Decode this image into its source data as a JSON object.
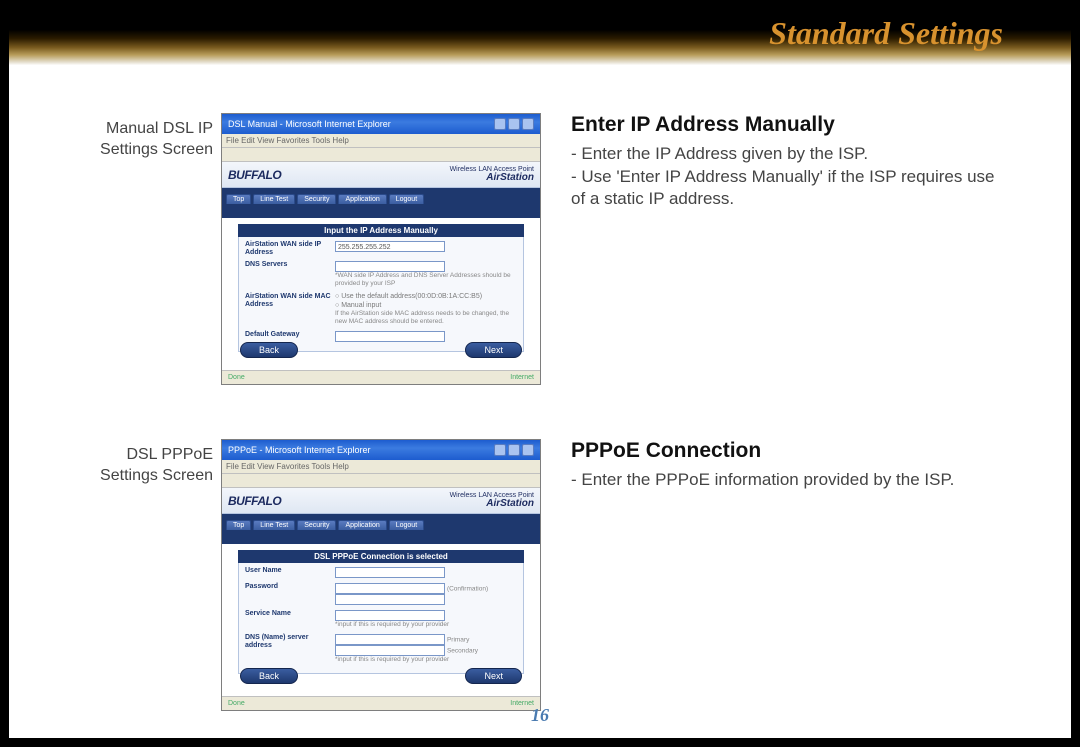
{
  "header": {
    "title": "Standard Settings"
  },
  "page_number": "16",
  "sections": [
    {
      "caption": "Manual DSL IP Settings Screen",
      "screenshot": {
        "window_title": "DSL Manual - Microsoft Internet Explorer",
        "menubar": "File   Edit   View   Favorites   Tools   Help",
        "brand": "BUFFALO",
        "brand_tag_top": "Wireless LAN Access Point",
        "brand_tag_bottom": "AirStation",
        "tabs": [
          "Top",
          "Line Test",
          "Security",
          "Application",
          "Logout"
        ],
        "panel_title": "Input the IP Address Manually",
        "fields": [
          {
            "label": "AirStation WAN side IP Address",
            "value_input": "255.255.255.252",
            "note": ""
          },
          {
            "label": "DNS Servers",
            "value_input": "",
            "note": "*WAN side IP Address and DNS Server Addresses should be provided by your ISP"
          },
          {
            "label": "AirStation WAN side MAC Address",
            "radio1": "Use the default address(00:0D:0B:1A:CC:B5)",
            "radio2": "Manual input",
            "note": "If the AirStation side MAC address needs to be changed, the new MAC address should be entered."
          },
          {
            "label": "Default Gateway",
            "value_input": "",
            "note": ""
          }
        ],
        "back": "Back",
        "next": "Next",
        "status_left": "Done",
        "status_right": "Internet"
      },
      "heading": "Enter IP Address Manually",
      "paragraphs": [
        "- Enter the IP Address given by the ISP.",
        "- Use 'Enter IP Address Manually' if the ISP requires use of a static IP address."
      ]
    },
    {
      "caption": "DSL PPPoE Settings Screen",
      "screenshot": {
        "window_title": "PPPoE - Microsoft Internet Explorer",
        "menubar": "File   Edit   View   Favorites   Tools   Help",
        "brand": "BUFFALO",
        "brand_tag_top": "Wireless LAN Access Point",
        "brand_tag_bottom": "AirStation",
        "tabs": [
          "Top",
          "Line Test",
          "Security",
          "Application",
          "Logout"
        ],
        "panel_title": "DSL PPPoE Connection is selected",
        "fields": [
          {
            "label": "User Name",
            "value_input": "",
            "note": ""
          },
          {
            "label": "Password",
            "value_input": "",
            "side": "(Confirmation)",
            "note": ""
          },
          {
            "label": "Service Name",
            "value_input": "",
            "note": "*input if this is required by your provider"
          },
          {
            "label": "DNS (Name) server address",
            "value_input": "",
            "side": "Primary",
            "side2": "Secondary",
            "note": "*input if this is required by your provider"
          }
        ],
        "back": "Back",
        "next": "Next",
        "status_left": "Done",
        "status_right": "Internet"
      },
      "heading": "PPPoE Connection",
      "paragraphs": [
        "- Enter the PPPoE information provided by the ISP."
      ]
    }
  ]
}
